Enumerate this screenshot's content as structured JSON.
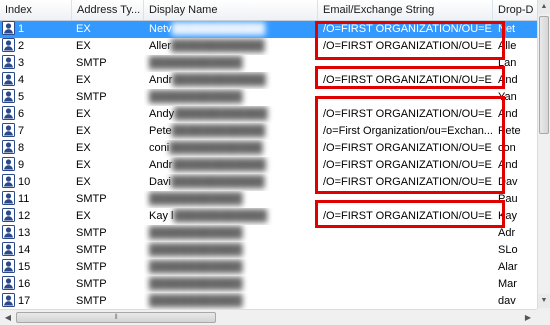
{
  "columns": {
    "index": "Index",
    "address_type": "Address Ty...",
    "display_name": "Display Name",
    "email": "Email/Exchange String",
    "drop_down": "Drop-D"
  },
  "rows": [
    {
      "index": "1",
      "type": "EX",
      "name": "Netv",
      "email": "/O=FIRST ORGANIZATION/OU=E...",
      "drop": "Net",
      "selected": true
    },
    {
      "index": "2",
      "type": "EX",
      "name": "Aller",
      "email": "/O=FIRST ORGANIZATION/OU=E...",
      "drop": "Alle"
    },
    {
      "index": "3",
      "type": "SMTP",
      "name": "",
      "email": "",
      "drop": "Lan"
    },
    {
      "index": "4",
      "type": "EX",
      "name": "Andr",
      "email": "/O=FIRST ORGANIZATION/OU=E...",
      "drop": "And"
    },
    {
      "index": "5",
      "type": "SMTP",
      "name": "",
      "email": "",
      "drop": "Yan"
    },
    {
      "index": "6",
      "type": "EX",
      "name": "Andy",
      "email": "/O=FIRST ORGANIZATION/OU=E...",
      "drop": "And"
    },
    {
      "index": "7",
      "type": "EX",
      "name": "Pete",
      "email": "/o=First Organization/ou=Exchan...",
      "drop": "Pete"
    },
    {
      "index": "8",
      "type": "EX",
      "name": "coni",
      "email": "/O=FIRST ORGANIZATION/OU=E...",
      "drop": "con"
    },
    {
      "index": "9",
      "type": "EX",
      "name": "Andr",
      "email": "/O=FIRST ORGANIZATION/OU=E...",
      "drop": "And"
    },
    {
      "index": "10",
      "type": "EX",
      "name": "Davi",
      "email": "/O=FIRST ORGANIZATION/OU=E...",
      "drop": "Dav"
    },
    {
      "index": "11",
      "type": "SMTP",
      "name": "",
      "email": "",
      "drop": "Pau"
    },
    {
      "index": "12",
      "type": "EX",
      "name": "Kay l",
      "email": "/O=FIRST ORGANIZATION/OU=E...",
      "drop": "Kay"
    },
    {
      "index": "13",
      "type": "SMTP",
      "name": "",
      "email": "",
      "drop": "Adr"
    },
    {
      "index": "14",
      "type": "SMTP",
      "name": "",
      "email": "",
      "drop": "SLo"
    },
    {
      "index": "15",
      "type": "SMTP",
      "name": "",
      "email": "",
      "drop": "Alar"
    },
    {
      "index": "16",
      "type": "SMTP",
      "name": "",
      "email": "",
      "drop": "Mar"
    },
    {
      "index": "17",
      "type": "SMTP",
      "name": "",
      "email": "",
      "drop": "dav"
    }
  ],
  "colors": {
    "selection": "#3399ff",
    "highlight": "#e10000"
  }
}
